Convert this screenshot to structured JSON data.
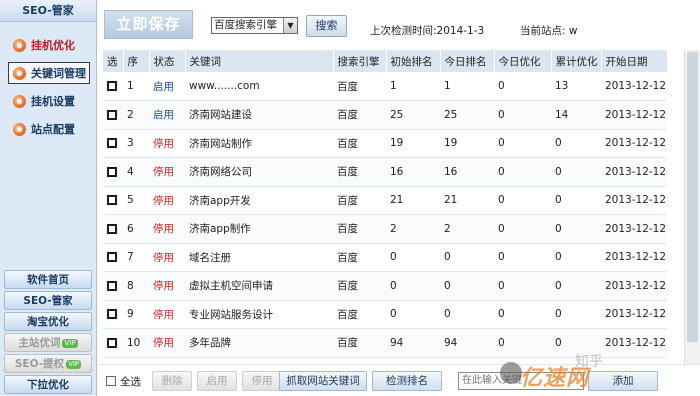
{
  "sidebar": {
    "title": "SEO-管家",
    "nav": [
      {
        "label": "挂机优化",
        "icon": "orange-circle-icon",
        "state": "active"
      },
      {
        "label": "关键词管理",
        "icon": "orange-circle-icon",
        "state": "selected"
      },
      {
        "label": "挂机设置",
        "icon": "orange-circle-icon",
        "state": "normal"
      },
      {
        "label": "站点配置",
        "icon": "orange-circle-icon",
        "state": "normal"
      }
    ],
    "bottom_links": [
      {
        "label": "软件首页",
        "disabled": false
      },
      {
        "label": "SEO-管家",
        "disabled": false
      },
      {
        "label": "淘宝优化",
        "disabled": false
      },
      {
        "label": "主站优词",
        "badge": "VIP",
        "disabled": true
      },
      {
        "label": "SEO-提权",
        "badge": "VIP",
        "disabled": true
      },
      {
        "label": "下拉优化",
        "disabled": false
      }
    ]
  },
  "toolbar": {
    "save_label": "立即保存",
    "engine_select": "百度搜索引擎",
    "search_label": "搜索",
    "last_check_label": "上次检测时间:",
    "last_check_value": "2014-1-3",
    "current_site_label": "当前站点:",
    "current_site_value": "w"
  },
  "table": {
    "headers": [
      "选",
      "序",
      "状态",
      "关键词",
      "搜索引擎",
      "初始排名",
      "今日排名",
      "今日优化",
      "累计优化",
      "开始日期"
    ],
    "rows": [
      {
        "idx": "1",
        "status": "启用",
        "status_on": true,
        "keyword": "www.......com",
        "engine": "百度",
        "init_rank": "1",
        "today_rank": "1",
        "today_opt": "0",
        "total_opt": "13",
        "start": "2013-12-12"
      },
      {
        "idx": "2",
        "status": "启用",
        "status_on": true,
        "keyword": "济南网站建设",
        "engine": "百度",
        "init_rank": "25",
        "today_rank": "25",
        "today_opt": "0",
        "total_opt": "14",
        "start": "2013-12-12"
      },
      {
        "idx": "3",
        "status": "停用",
        "status_on": false,
        "keyword": "济南网站制作",
        "engine": "百度",
        "init_rank": "19",
        "today_rank": "19",
        "today_opt": "0",
        "total_opt": "0",
        "start": "2013-12-12"
      },
      {
        "idx": "4",
        "status": "停用",
        "status_on": false,
        "keyword": "济南网络公司",
        "engine": "百度",
        "init_rank": "16",
        "today_rank": "16",
        "today_opt": "0",
        "total_opt": "0",
        "start": "2013-12-12"
      },
      {
        "idx": "5",
        "status": "停用",
        "status_on": false,
        "keyword": "济南app开发",
        "engine": "百度",
        "init_rank": "21",
        "today_rank": "21",
        "today_opt": "0",
        "total_opt": "0",
        "start": "2013-12-12"
      },
      {
        "idx": "6",
        "status": "停用",
        "status_on": false,
        "keyword": "济南app制作",
        "engine": "百度",
        "init_rank": "2",
        "today_rank": "2",
        "today_opt": "0",
        "total_opt": "0",
        "start": "2013-12-12"
      },
      {
        "idx": "7",
        "status": "停用",
        "status_on": false,
        "keyword": "域名注册",
        "engine": "百度",
        "init_rank": "0",
        "today_rank": "0",
        "today_opt": "0",
        "total_opt": "0",
        "start": "2013-12-12"
      },
      {
        "idx": "8",
        "status": "停用",
        "status_on": false,
        "keyword": "虚拟主机空间申请",
        "engine": "百度",
        "init_rank": "0",
        "today_rank": "0",
        "today_opt": "0",
        "total_opt": "0",
        "start": "2013-12-12"
      },
      {
        "idx": "9",
        "status": "停用",
        "status_on": false,
        "keyword": "专业网站服务设计",
        "engine": "百度",
        "init_rank": "0",
        "today_rank": "0",
        "today_opt": "0",
        "total_opt": "0",
        "start": "2013-12-12"
      },
      {
        "idx": "10",
        "status": "停用",
        "status_on": false,
        "keyword": "多年品牌",
        "engine": "百度",
        "init_rank": "94",
        "today_rank": "94",
        "today_opt": "0",
        "total_opt": "0",
        "start": "2013-12-12"
      }
    ]
  },
  "footer": {
    "select_all": "全选",
    "delete": "删除",
    "enable": "启用",
    "disable": "停用",
    "fetch": "抓取网站关键词",
    "detect": "检测排名",
    "keyword_placeholder": "在此输入关键",
    "add": "添加"
  },
  "watermark": {
    "text": "亿速网",
    "zh": "知乎"
  },
  "colors": {
    "status_on": "#1a4aa8",
    "status_off": "#d42222",
    "sidebar_bg": "#dde9f6",
    "header_bg": "#dbe6f3"
  }
}
